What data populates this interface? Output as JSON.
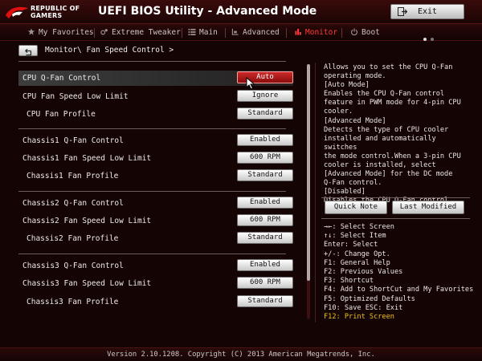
{
  "header": {
    "logo_line1": "REPUBLIC OF",
    "logo_line2": "GAMERS",
    "title": "UEFI BIOS Utility - Advanced Mode",
    "exit_label": "Exit"
  },
  "tabs": [
    {
      "label": "My Favorites",
      "icon": "star-icon"
    },
    {
      "label": "Extreme Tweaker",
      "icon": "tweaker-icon"
    },
    {
      "label": "Main",
      "icon": "list-icon"
    },
    {
      "label": "Advanced",
      "icon": "advanced-icon"
    },
    {
      "label": "Monitor",
      "icon": "monitor-icon",
      "active": true
    },
    {
      "label": "Boot",
      "icon": "power-icon"
    }
  ],
  "breadcrumb": "Monitor\\ Fan Speed Control >",
  "settings": [
    {
      "label": "CPU Q-Fan Control",
      "value": "Auto"
    },
    {
      "label": "CPU Fan Speed Low Limit",
      "value": "Ignore"
    },
    {
      "label": "CPU Fan Profile",
      "value": "Standard"
    },
    {
      "label": "Chassis1 Q-Fan Control",
      "value": "Enabled"
    },
    {
      "label": "Chassis1 Fan Speed Low Limit",
      "value": "600 RPM"
    },
    {
      "label": "Chassis1 Fan Profile",
      "value": "Standard"
    },
    {
      "label": "Chassis2 Q-Fan Control",
      "value": "Enabled"
    },
    {
      "label": "Chassis2 Fan Speed Low Limit",
      "value": "600 RPM"
    },
    {
      "label": "Chassis2 Fan Profile",
      "value": "Standard"
    },
    {
      "label": "Chassis3 Q-Fan Control",
      "value": "Enabled"
    },
    {
      "label": "Chassis3 Fan Speed Low Limit",
      "value": "600 RPM"
    },
    {
      "label": "Chassis3 Fan Profile",
      "value": "Standard"
    }
  ],
  "help": {
    "text": "Allows you to set the CPU Q-Fan\noperating mode.\n[Auto Mode]\nEnables the CPU Q-Fan control\nfeature in PWM mode for 4-pin CPU\ncooler.\n[Advanced Mode]\nDetects the type of CPU cooler\ninstalled and automatically switches\nthe mode control.When a 3-pin CPU\ncooler is installed, select\n[Advanced Mode] for the DC mode\nQ-Fan control.\n[Disabled]\nDisables the CPU Q-Fan control.",
    "quick_note": "Quick Note",
    "last_modified": "Last Modified",
    "keys": [
      "→←: Select Screen",
      "↑↓: Select Item",
      "Enter: Select",
      "+/-: Change Opt.",
      "F1: General Help",
      "F2: Previous Values",
      "F3: Shortcut",
      "F4: Add to ShortCut and My Favorites",
      "F5: Optimized Defaults",
      "F10: Save  ESC: Exit",
      "F12: Print Screen"
    ]
  },
  "footer": "Version 2.10.1208. Copyright (C) 2013 American Megatrends, Inc.",
  "colors": {
    "accent": "#ff3b3b",
    "selected_value": "#b51b1b",
    "key_highlight": "#f0c419"
  }
}
